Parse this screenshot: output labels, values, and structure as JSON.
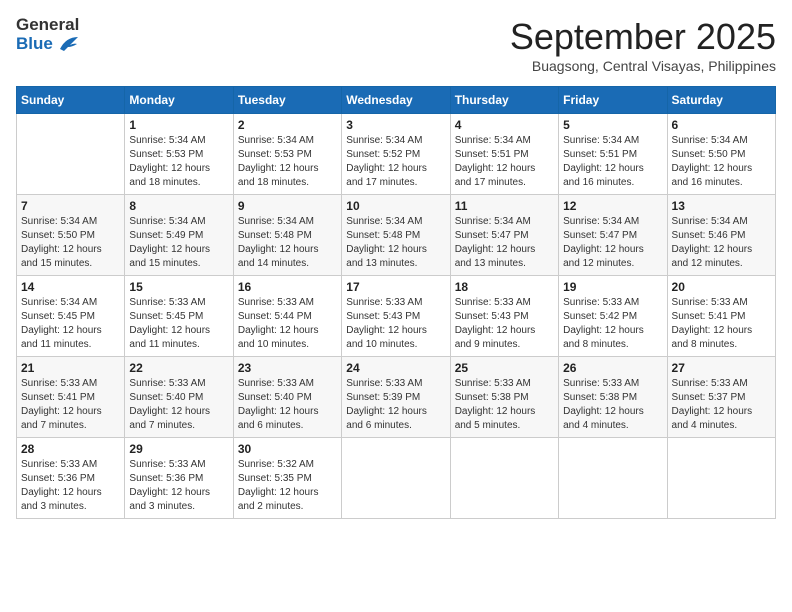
{
  "logo": {
    "general": "General",
    "blue": "Blue"
  },
  "title": "September 2025",
  "location": "Buagsong, Central Visayas, Philippines",
  "days_of_week": [
    "Sunday",
    "Monday",
    "Tuesday",
    "Wednesday",
    "Thursday",
    "Friday",
    "Saturday"
  ],
  "weeks": [
    [
      {
        "day": "",
        "content": ""
      },
      {
        "day": "1",
        "content": "Sunrise: 5:34 AM\nSunset: 5:53 PM\nDaylight: 12 hours\nand 18 minutes."
      },
      {
        "day": "2",
        "content": "Sunrise: 5:34 AM\nSunset: 5:53 PM\nDaylight: 12 hours\nand 18 minutes."
      },
      {
        "day": "3",
        "content": "Sunrise: 5:34 AM\nSunset: 5:52 PM\nDaylight: 12 hours\nand 17 minutes."
      },
      {
        "day": "4",
        "content": "Sunrise: 5:34 AM\nSunset: 5:51 PM\nDaylight: 12 hours\nand 17 minutes."
      },
      {
        "day": "5",
        "content": "Sunrise: 5:34 AM\nSunset: 5:51 PM\nDaylight: 12 hours\nand 16 minutes."
      },
      {
        "day": "6",
        "content": "Sunrise: 5:34 AM\nSunset: 5:50 PM\nDaylight: 12 hours\nand 16 minutes."
      }
    ],
    [
      {
        "day": "7",
        "content": "Sunrise: 5:34 AM\nSunset: 5:50 PM\nDaylight: 12 hours\nand 15 minutes."
      },
      {
        "day": "8",
        "content": "Sunrise: 5:34 AM\nSunset: 5:49 PM\nDaylight: 12 hours\nand 15 minutes."
      },
      {
        "day": "9",
        "content": "Sunrise: 5:34 AM\nSunset: 5:48 PM\nDaylight: 12 hours\nand 14 minutes."
      },
      {
        "day": "10",
        "content": "Sunrise: 5:34 AM\nSunset: 5:48 PM\nDaylight: 12 hours\nand 13 minutes."
      },
      {
        "day": "11",
        "content": "Sunrise: 5:34 AM\nSunset: 5:47 PM\nDaylight: 12 hours\nand 13 minutes."
      },
      {
        "day": "12",
        "content": "Sunrise: 5:34 AM\nSunset: 5:47 PM\nDaylight: 12 hours\nand 12 minutes."
      },
      {
        "day": "13",
        "content": "Sunrise: 5:34 AM\nSunset: 5:46 PM\nDaylight: 12 hours\nand 12 minutes."
      }
    ],
    [
      {
        "day": "14",
        "content": "Sunrise: 5:34 AM\nSunset: 5:45 PM\nDaylight: 12 hours\nand 11 minutes."
      },
      {
        "day": "15",
        "content": "Sunrise: 5:33 AM\nSunset: 5:45 PM\nDaylight: 12 hours\nand 11 minutes."
      },
      {
        "day": "16",
        "content": "Sunrise: 5:33 AM\nSunset: 5:44 PM\nDaylight: 12 hours\nand 10 minutes."
      },
      {
        "day": "17",
        "content": "Sunrise: 5:33 AM\nSunset: 5:43 PM\nDaylight: 12 hours\nand 10 minutes."
      },
      {
        "day": "18",
        "content": "Sunrise: 5:33 AM\nSunset: 5:43 PM\nDaylight: 12 hours\nand 9 minutes."
      },
      {
        "day": "19",
        "content": "Sunrise: 5:33 AM\nSunset: 5:42 PM\nDaylight: 12 hours\nand 8 minutes."
      },
      {
        "day": "20",
        "content": "Sunrise: 5:33 AM\nSunset: 5:41 PM\nDaylight: 12 hours\nand 8 minutes."
      }
    ],
    [
      {
        "day": "21",
        "content": "Sunrise: 5:33 AM\nSunset: 5:41 PM\nDaylight: 12 hours\nand 7 minutes."
      },
      {
        "day": "22",
        "content": "Sunrise: 5:33 AM\nSunset: 5:40 PM\nDaylight: 12 hours\nand 7 minutes."
      },
      {
        "day": "23",
        "content": "Sunrise: 5:33 AM\nSunset: 5:40 PM\nDaylight: 12 hours\nand 6 minutes."
      },
      {
        "day": "24",
        "content": "Sunrise: 5:33 AM\nSunset: 5:39 PM\nDaylight: 12 hours\nand 6 minutes."
      },
      {
        "day": "25",
        "content": "Sunrise: 5:33 AM\nSunset: 5:38 PM\nDaylight: 12 hours\nand 5 minutes."
      },
      {
        "day": "26",
        "content": "Sunrise: 5:33 AM\nSunset: 5:38 PM\nDaylight: 12 hours\nand 4 minutes."
      },
      {
        "day": "27",
        "content": "Sunrise: 5:33 AM\nSunset: 5:37 PM\nDaylight: 12 hours\nand 4 minutes."
      }
    ],
    [
      {
        "day": "28",
        "content": "Sunrise: 5:33 AM\nSunset: 5:36 PM\nDaylight: 12 hours\nand 3 minutes."
      },
      {
        "day": "29",
        "content": "Sunrise: 5:33 AM\nSunset: 5:36 PM\nDaylight: 12 hours\nand 3 minutes."
      },
      {
        "day": "30",
        "content": "Sunrise: 5:32 AM\nSunset: 5:35 PM\nDaylight: 12 hours\nand 2 minutes."
      },
      {
        "day": "",
        "content": ""
      },
      {
        "day": "",
        "content": ""
      },
      {
        "day": "",
        "content": ""
      },
      {
        "day": "",
        "content": ""
      }
    ]
  ]
}
